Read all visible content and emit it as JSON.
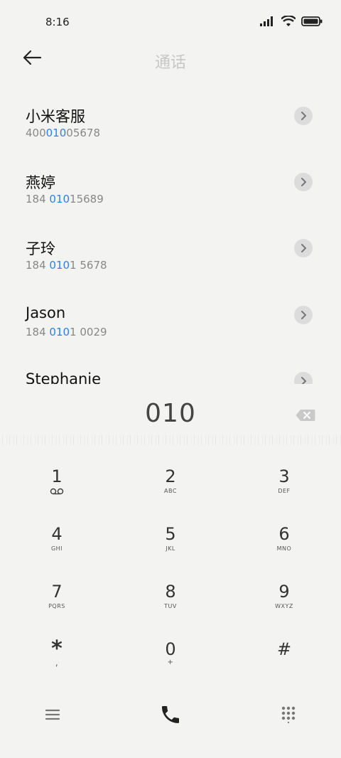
{
  "status_bar": {
    "time": "8:16"
  },
  "header": {
    "title": "通话"
  },
  "contacts": [
    {
      "name": "小米客服",
      "number_pre": "400",
      "number_match": "010",
      "number_post": "05678"
    },
    {
      "name": "燕婷",
      "number_pre": "184 ",
      "number_match": "010",
      "number_post": "15689"
    },
    {
      "name": "子玲",
      "number_pre": "184 ",
      "number_match": "010",
      "number_post": "1 5678"
    },
    {
      "name": "Jason",
      "number_pre": "184 ",
      "number_match": "010",
      "number_post": "1 0029"
    },
    {
      "name": "Stephanie",
      "number_pre": "",
      "number_match": "",
      "number_post": ""
    }
  ],
  "dial_input": {
    "value": "010"
  },
  "keypad": [
    {
      "digit": "1",
      "letters": ""
    },
    {
      "digit": "2",
      "letters": "ABC"
    },
    {
      "digit": "3",
      "letters": "DEF"
    },
    {
      "digit": "4",
      "letters": "GHI"
    },
    {
      "digit": "5",
      "letters": "JKL"
    },
    {
      "digit": "6",
      "letters": "MNO"
    },
    {
      "digit": "7",
      "letters": "PQRS"
    },
    {
      "digit": "8",
      "letters": "TUV"
    },
    {
      "digit": "9",
      "letters": "WXYZ"
    },
    {
      "digit": "*",
      "letters": ","
    },
    {
      "digit": "0",
      "letters": "+"
    },
    {
      "digit": "#",
      "letters": ""
    }
  ],
  "colors": {
    "accent": "#2a82e4",
    "background": "#f3f3f2",
    "muted": "#888888"
  },
  "icons": {
    "back": "back-arrow-icon",
    "arrow": "chevron-right-icon",
    "delete": "backspace-icon",
    "menu": "menu-icon",
    "call": "phone-icon",
    "dialpad": "dialpad-icon",
    "voicemail": "voicemail-icon"
  }
}
